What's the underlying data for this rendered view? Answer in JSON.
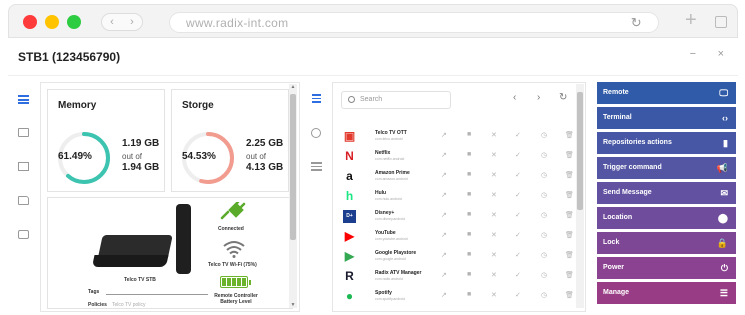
{
  "browser": {
    "url": "www.radix-int.com",
    "nav_back": "‹",
    "nav_forward": "›",
    "reload": "↻",
    "new_tab": "+",
    "dots": [
      "#ff3b3b",
      "#ffc300",
      "#2ecc40"
    ]
  },
  "header": {
    "title": "STB1 (123456790)",
    "minimize": "−",
    "close": "×"
  },
  "rail": {
    "icons": [
      "list-icon",
      "chat-icon",
      "image-icon",
      "folder-icon",
      "drive-icon"
    ]
  },
  "memory": {
    "title": "Memory",
    "percent_label": "61.49%",
    "percent": 61.49,
    "used": "1.19 GB",
    "out_of": "out of",
    "total": "1.94 GB",
    "color": "#3cc4b0"
  },
  "storage": {
    "title": "Storge",
    "percent_label": "54.53%",
    "percent": 54.53,
    "used": "2.25 GB",
    "out_of": "out of",
    "total": "4.13 GB",
    "color": "#f29b8f"
  },
  "device": {
    "name": "Telco TV STB",
    "connected": "Connected",
    "wifi": "Telco TV Wi-Fi (75%)",
    "battery": "Remote Controller Battery Level",
    "tags_label": "Tags",
    "policies_label": "Policies",
    "policies_value": "Telco TV policy"
  },
  "apps": {
    "search_placeholder": "Search",
    "prev": "‹",
    "next": "›",
    "refresh": "↻",
    "items": [
      {
        "name": "Telco TV OTT",
        "sub": "com.telco.android",
        "logo": "▣",
        "color": "#e23b2e"
      },
      {
        "name": "Netflix",
        "sub": "com.netflix.android",
        "logo": "N",
        "color": "#d81f26"
      },
      {
        "name": "Amazon Prime",
        "sub": "com.amazon.android",
        "logo": "a",
        "color": "#111111"
      },
      {
        "name": "Hulu",
        "sub": "com.hulu.android",
        "logo": "h",
        "color": "#1ce783"
      },
      {
        "name": "Disney+",
        "sub": "com.disney.android",
        "logo": "D+",
        "color": "#1b3e8f"
      },
      {
        "name": "YouTube",
        "sub": "com.youtube.android",
        "logo": "▶",
        "color": "#ff0000"
      },
      {
        "name": "Google Playstore",
        "sub": "com.google.android",
        "logo": "▶",
        "color": "#34a853"
      },
      {
        "name": "Radix ATV Manager",
        "sub": "com.radix.android",
        "logo": "R",
        "color": "#1a1a2e"
      },
      {
        "name": "Spotify",
        "sub": "com.spotify.android",
        "logo": "●",
        "color": "#1db954"
      }
    ],
    "action_icons": [
      "external-link-icon",
      "stop-icon",
      "close-icon",
      "check-icon",
      "clock-icon",
      "trash-icon"
    ],
    "action_glyphs": [
      "↗",
      "■",
      "✕",
      "✓",
      "◷",
      "🗑"
    ]
  },
  "actions": [
    {
      "label": "Remote",
      "icon": "🖵",
      "color": "#2f5ba8"
    },
    {
      "label": "Terminal",
      "icon": "‹›",
      "color": "#3a58a6"
    },
    {
      "label": "Repositories actions",
      "icon": "▮",
      "color": "#4757a5"
    },
    {
      "label": "Trigger command",
      "icon": "📢",
      "color": "#5455a3"
    },
    {
      "label": "Send Message",
      "icon": "✉",
      "color": "#6251a1"
    },
    {
      "label": "Location",
      "icon": "⬤",
      "color": "#704c9c"
    },
    {
      "label": "Lock",
      "icon": "🔒",
      "color": "#7e4796"
    },
    {
      "label": "Power",
      "icon": "⏻",
      "color": "#8b4290"
    },
    {
      "label": "Manage",
      "icon": "☰",
      "color": "#993c86"
    }
  ]
}
